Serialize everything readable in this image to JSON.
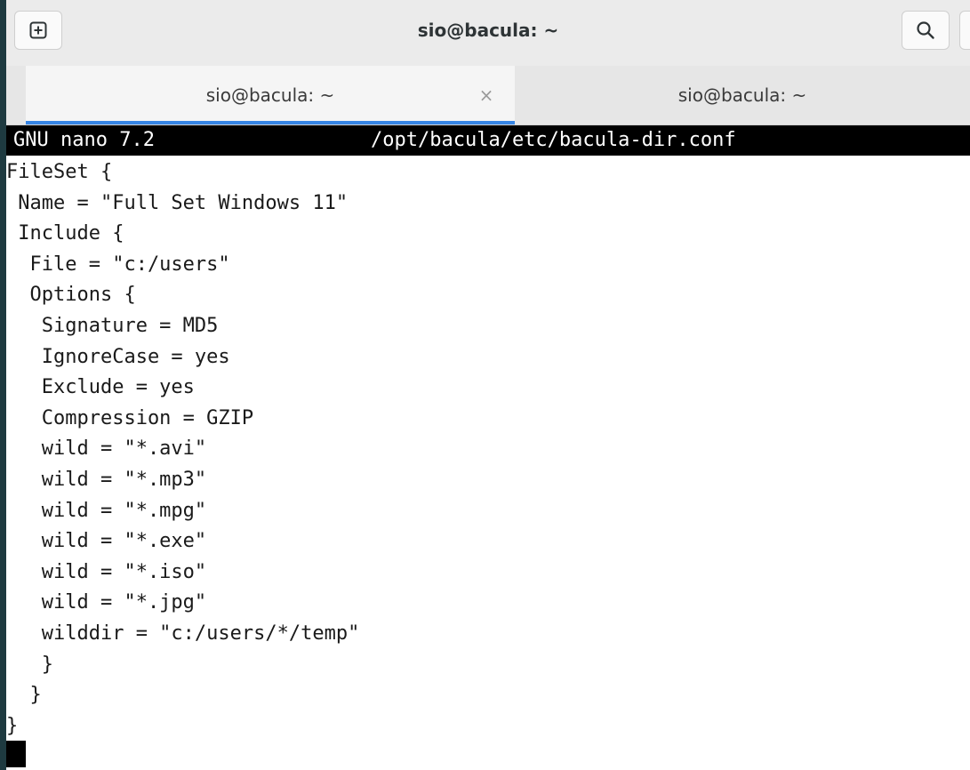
{
  "window": {
    "title": "sio@bacula: ~"
  },
  "tabs": [
    {
      "label": "sio@bacula: ~",
      "active": true,
      "close_glyph": "×"
    },
    {
      "label": "sio@bacula: ~",
      "active": false
    }
  ],
  "icons": {
    "new_tab": "plus-in-square-icon",
    "search": "magnifier-icon"
  },
  "colors": {
    "tab_indicator": "#3584e4",
    "nano_bar_bg": "#000000",
    "nano_bar_fg": "#ffffff"
  },
  "nano": {
    "version": "GNU nano 7.2",
    "filename": "/opt/bacula/etc/bacula-dir.conf"
  },
  "file_lines": [
    "FileSet {",
    " Name = \"Full Set Windows 11\"",
    " Include {",
    "  File = \"c:/users\"",
    "  Options {",
    "   Signature = MD5",
    "   IgnoreCase = yes",
    "   Exclude = yes",
    "   Compression = GZIP",
    "   wild = \"*.avi\"",
    "   wild = \"*.mp3\"",
    "   wild = \"*.mpg\"",
    "   wild = \"*.exe\"",
    "   wild = \"*.iso\"",
    "   wild = \"*.jpg\"",
    "   wilddir = \"c:/users/*/temp\"",
    "   }",
    "  }",
    "}"
  ]
}
